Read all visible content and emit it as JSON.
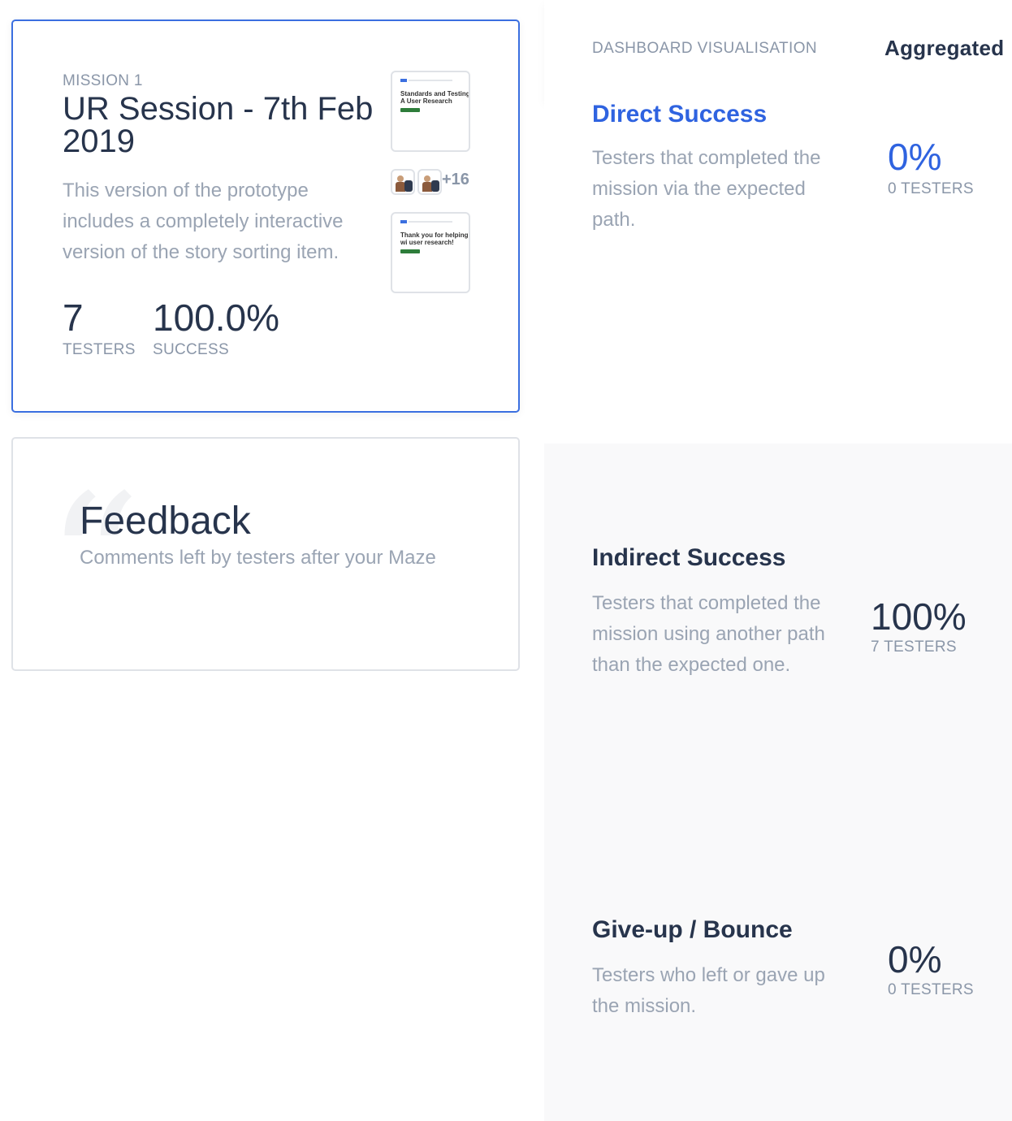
{
  "mission": {
    "label": "MISSION 1",
    "title": "UR Session - 7th Feb 2019",
    "description": "This version of the prototype includes a completely interactive version of the story sorting item.",
    "testers_count": "7",
    "testers_label": "TESTERS",
    "success_value": "100.0%",
    "success_label": "SUCCESS",
    "screens": [
      {
        "title": "Standards and Testing A User Research"
      },
      {
        "title": "Thank you for helping wi user research!"
      }
    ],
    "extra_avatars": "+16"
  },
  "feedback": {
    "title": "Feedback",
    "subtitle": "Comments left by testers after your Maze"
  },
  "dashboard": {
    "label": "DASHBOARD VISUALISATION",
    "value": "Aggregated"
  },
  "metrics": {
    "direct": {
      "title": "Direct Success",
      "description": "Testers that completed the mission via the expected path.",
      "percent": "0%",
      "count": "0 TESTERS"
    },
    "indirect": {
      "title": "Indirect Success",
      "description": "Testers that completed the mission using another path than the expected one.",
      "percent": "100%",
      "count": "7 TESTERS"
    },
    "giveup": {
      "title": "Give-up / Bounce",
      "description": "Testers who left or gave up the mission.",
      "percent": "0%",
      "count": "0 TESTERS"
    }
  },
  "colors": {
    "accent": "#2f63e0",
    "heading": "#27344c",
    "muted": "#9aa4b3"
  }
}
